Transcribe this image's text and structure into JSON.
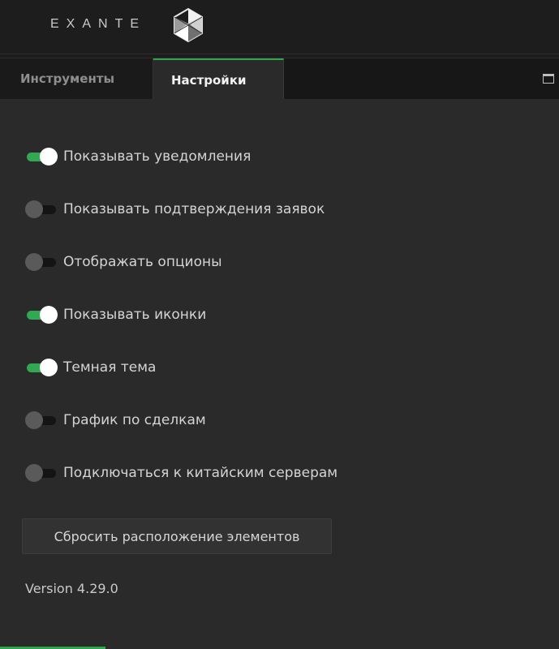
{
  "header": {
    "brand": "EXANTE",
    "logo_icon": "exante-logo-icon"
  },
  "tabs": [
    {
      "label": "Инструменты",
      "active": false
    },
    {
      "label": "Настройки",
      "active": true
    }
  ],
  "window_controls": {
    "maximize_icon": "maximize-icon"
  },
  "settings": {
    "items": [
      {
        "label": "Показывать уведомления",
        "enabled": true
      },
      {
        "label": "Показывать подтверждения заявок",
        "enabled": false
      },
      {
        "label": "Отображать опционы",
        "enabled": false
      },
      {
        "label": "Показывать иконки",
        "enabled": true
      },
      {
        "label": "Темная тема",
        "enabled": true
      },
      {
        "label": "График по сделкам",
        "enabled": false
      },
      {
        "label": "Подключаться к китайским серверам",
        "enabled": false
      }
    ],
    "reset_label": "Сбросить расположение элементов",
    "version": "Version 4.29.0"
  },
  "colors": {
    "accent": "#32a852",
    "background": "#2a2a2a",
    "header": "#1d1d1d"
  }
}
